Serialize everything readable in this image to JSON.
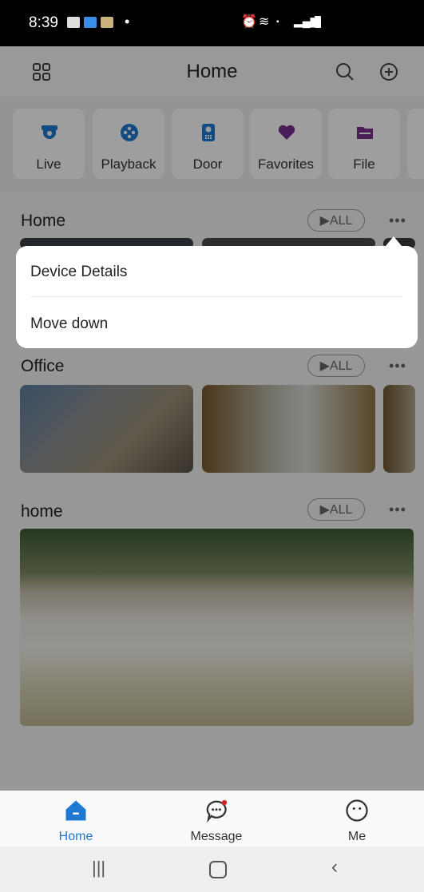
{
  "status_bar": {
    "time": "8:39"
  },
  "header": {
    "title": "Home"
  },
  "quick_actions": [
    {
      "label": "Live",
      "icon": "live-camera-icon",
      "color": "#1f78d1"
    },
    {
      "label": "Playback",
      "icon": "playback-icon",
      "color": "#1f78d1"
    },
    {
      "label": "Door",
      "icon": "door-intercom-icon",
      "color": "#1f78d1"
    },
    {
      "label": "Favorites",
      "icon": "heart-icon",
      "color": "#7a2f8f"
    },
    {
      "label": "File",
      "icon": "folder-icon",
      "color": "#7a2f8f"
    }
  ],
  "groups": [
    {
      "title": "Home",
      "all_label": "▶ALL"
    },
    {
      "title": "Office",
      "all_label": "▶ALL"
    },
    {
      "title": "home",
      "all_label": "▶ALL"
    }
  ],
  "popup": {
    "items": [
      "Device Details",
      "Move down"
    ]
  },
  "tabbar": {
    "tabs": [
      {
        "label": "Home",
        "active": true
      },
      {
        "label": "Message",
        "active": false
      },
      {
        "label": "Me",
        "active": false
      }
    ]
  },
  "colors": {
    "accent": "#1f78d1"
  }
}
